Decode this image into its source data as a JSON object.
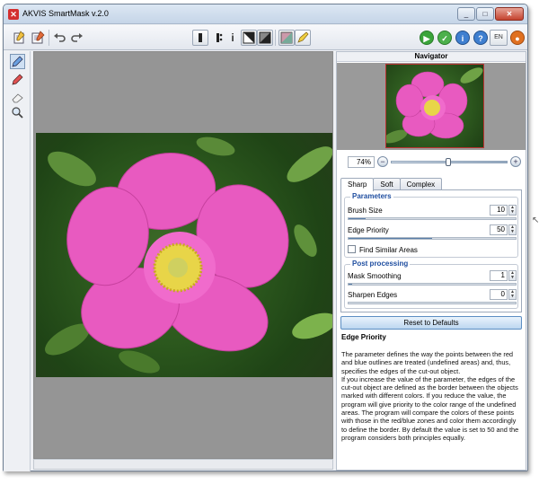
{
  "window": {
    "title": "AKVIS SmartMask v.2.0",
    "controls": [
      "_",
      "□",
      "✕"
    ]
  },
  "toolbar": {
    "language": "EN"
  },
  "navigator": {
    "title": "Navigator",
    "zoom": "74%",
    "zoom_fraction": 0.48
  },
  "tabs": [
    {
      "label": "Sharp",
      "active": true
    },
    {
      "label": "Soft",
      "active": false
    },
    {
      "label": "Complex",
      "active": false
    }
  ],
  "parameters": {
    "title": "Parameters",
    "brush_size": {
      "label": "Brush Size",
      "value": "10",
      "fraction": 0.1
    },
    "edge_priority": {
      "label": "Edge Priority",
      "value": "50",
      "fraction": 0.5
    },
    "find_similar": {
      "label": "Find Similar Areas",
      "checked": false
    }
  },
  "post_processing": {
    "title": "Post processing",
    "mask_smoothing": {
      "label": "Mask Smoothing",
      "value": "1",
      "fraction": 0.02
    },
    "sharpen_edges": {
      "label": "Sharpen Edges",
      "value": "0",
      "fraction": 0.0
    }
  },
  "reset_label": "Reset to Defaults",
  "help": {
    "title": "Edge Priority",
    "text": "The parameter defines the way the points between the red and blue outlines are treated (undefined areas) and, thus, specifies the edges of the cut-out object.\nIf you increase the value of the parameter, the edges of the cut-out object are defined as the border between the objects marked with different colors. If you reduce the value, the program will give priority to the color range of the undefined areas. The program will compare the colors of these points with those in the red/blue zones and color them accordingly to define the border. By default the value is set to 50 and the program considers both principles equally."
  },
  "icons": {
    "left_tools": [
      "blue-pencil-icon",
      "red-pencil-icon",
      "eraser-icon",
      "zoom-icon"
    ],
    "toolbar_left": [
      "open-icon",
      "save-icon",
      "undo-icon",
      "redo-icon"
    ],
    "toolbar_mid": [
      "show-image-icon",
      "show-strokes-icon",
      "info-icon",
      "bw-mask-icon",
      "mask-icon",
      "color-mask-icon",
      "highlighter-icon"
    ],
    "toolbar_right": [
      "run-icon",
      "apply-icon",
      "help-icon",
      "settings-icon",
      "language-icon",
      "akvis-icon"
    ]
  },
  "colors": {
    "accent": "#1f4ea0",
    "flower": "#e85ac0",
    "center": "#e8d548"
  }
}
